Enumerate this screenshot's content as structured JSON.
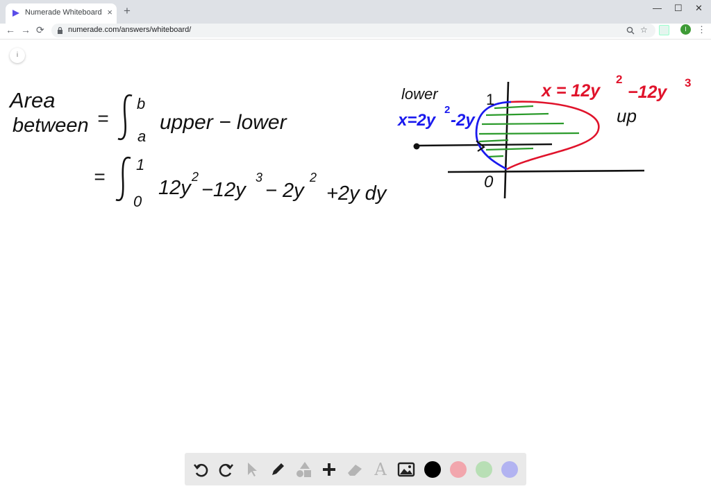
{
  "browser": {
    "tab_title": "Numerade Whiteboard",
    "tab_close": "×",
    "new_tab": "+",
    "url": "numerade.com/answers/whiteboard/",
    "window_controls": {
      "minimize": "—",
      "maximize": "☐",
      "close": "✕"
    },
    "nav": {
      "back": "←",
      "forward": "→",
      "reload": "⟳"
    },
    "profile_initial": "I",
    "menu": "⋮"
  },
  "whiteboard": {
    "info_label": "i",
    "handwriting": {
      "line1_a": "Area",
      "line1_b": "between",
      "eq1": "=",
      "integral_upper": "b",
      "integral_lower": "a",
      "integrand1": "upper − lower",
      "eq2": "=",
      "integral2_upper": "1",
      "integral2_lower": "0",
      "integrand2_a": "12y",
      "integrand2_exp_a": "2",
      "integrand2_b": "−12y",
      "integrand2_exp_b": "3",
      "integrand2_c": "− 2y",
      "integrand2_exp_c": "2",
      "integrand2_d": "+2y  dy",
      "graph_lower_label": "lower",
      "graph_lower_eq": "x=2y",
      "graph_lower_eq_exp": "2",
      "graph_lower_eq_tail": "-2y",
      "graph_upper_eq": "x = 12y",
      "graph_upper_eq_exp1": "2",
      "graph_upper_eq_mid": "−12y",
      "graph_upper_eq_exp2": "3",
      "graph_upper_label": "up",
      "graph_one": "1",
      "graph_zero": "0"
    },
    "ink_colors": {
      "black": "#111111",
      "blue": "#1a1aee",
      "red": "#e0132b",
      "green": "#2a9a2a"
    }
  },
  "palette": {
    "tools": [
      "undo-icon",
      "redo-icon",
      "pointer-icon",
      "pen-icon",
      "shapes-icon",
      "add-icon",
      "eraser-icon",
      "text-icon",
      "image-icon"
    ],
    "text_tool_label": "A",
    "colors": [
      "#000000",
      "#f2a6ad",
      "#b8dfb5",
      "#b2b3f1"
    ]
  }
}
